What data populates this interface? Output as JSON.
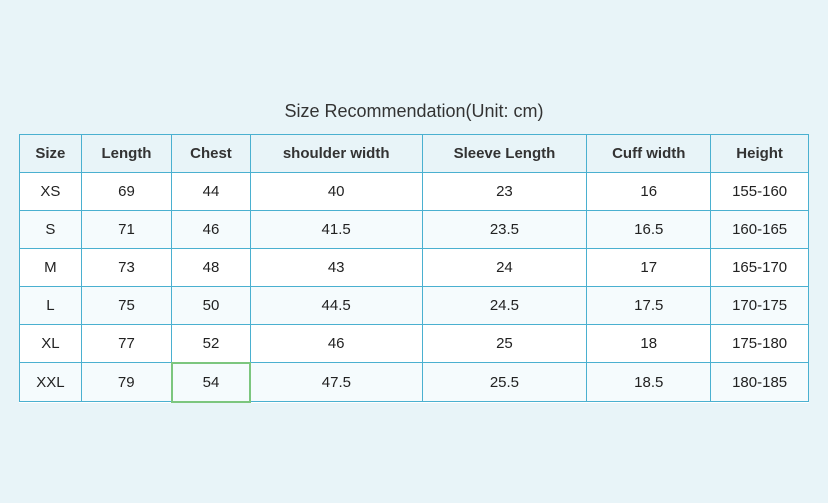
{
  "title": "Size Recommendation(Unit: cm)",
  "table": {
    "headers": [
      "Size",
      "Length",
      "Chest",
      "shoulder width",
      "Sleeve Length",
      "Cuff width",
      "Height"
    ],
    "rows": [
      [
        "XS",
        "69",
        "44",
        "40",
        "23",
        "16",
        "155-160"
      ],
      [
        "S",
        "71",
        "46",
        "41.5",
        "23.5",
        "16.5",
        "160-165"
      ],
      [
        "M",
        "73",
        "48",
        "43",
        "24",
        "17",
        "165-170"
      ],
      [
        "L",
        "75",
        "50",
        "44.5",
        "24.5",
        "17.5",
        "170-175"
      ],
      [
        "XL",
        "77",
        "52",
        "46",
        "25",
        "18",
        "175-180"
      ],
      [
        "XXL",
        "79",
        "54",
        "47.5",
        "25.5",
        "18.5",
        "180-185"
      ]
    ]
  }
}
